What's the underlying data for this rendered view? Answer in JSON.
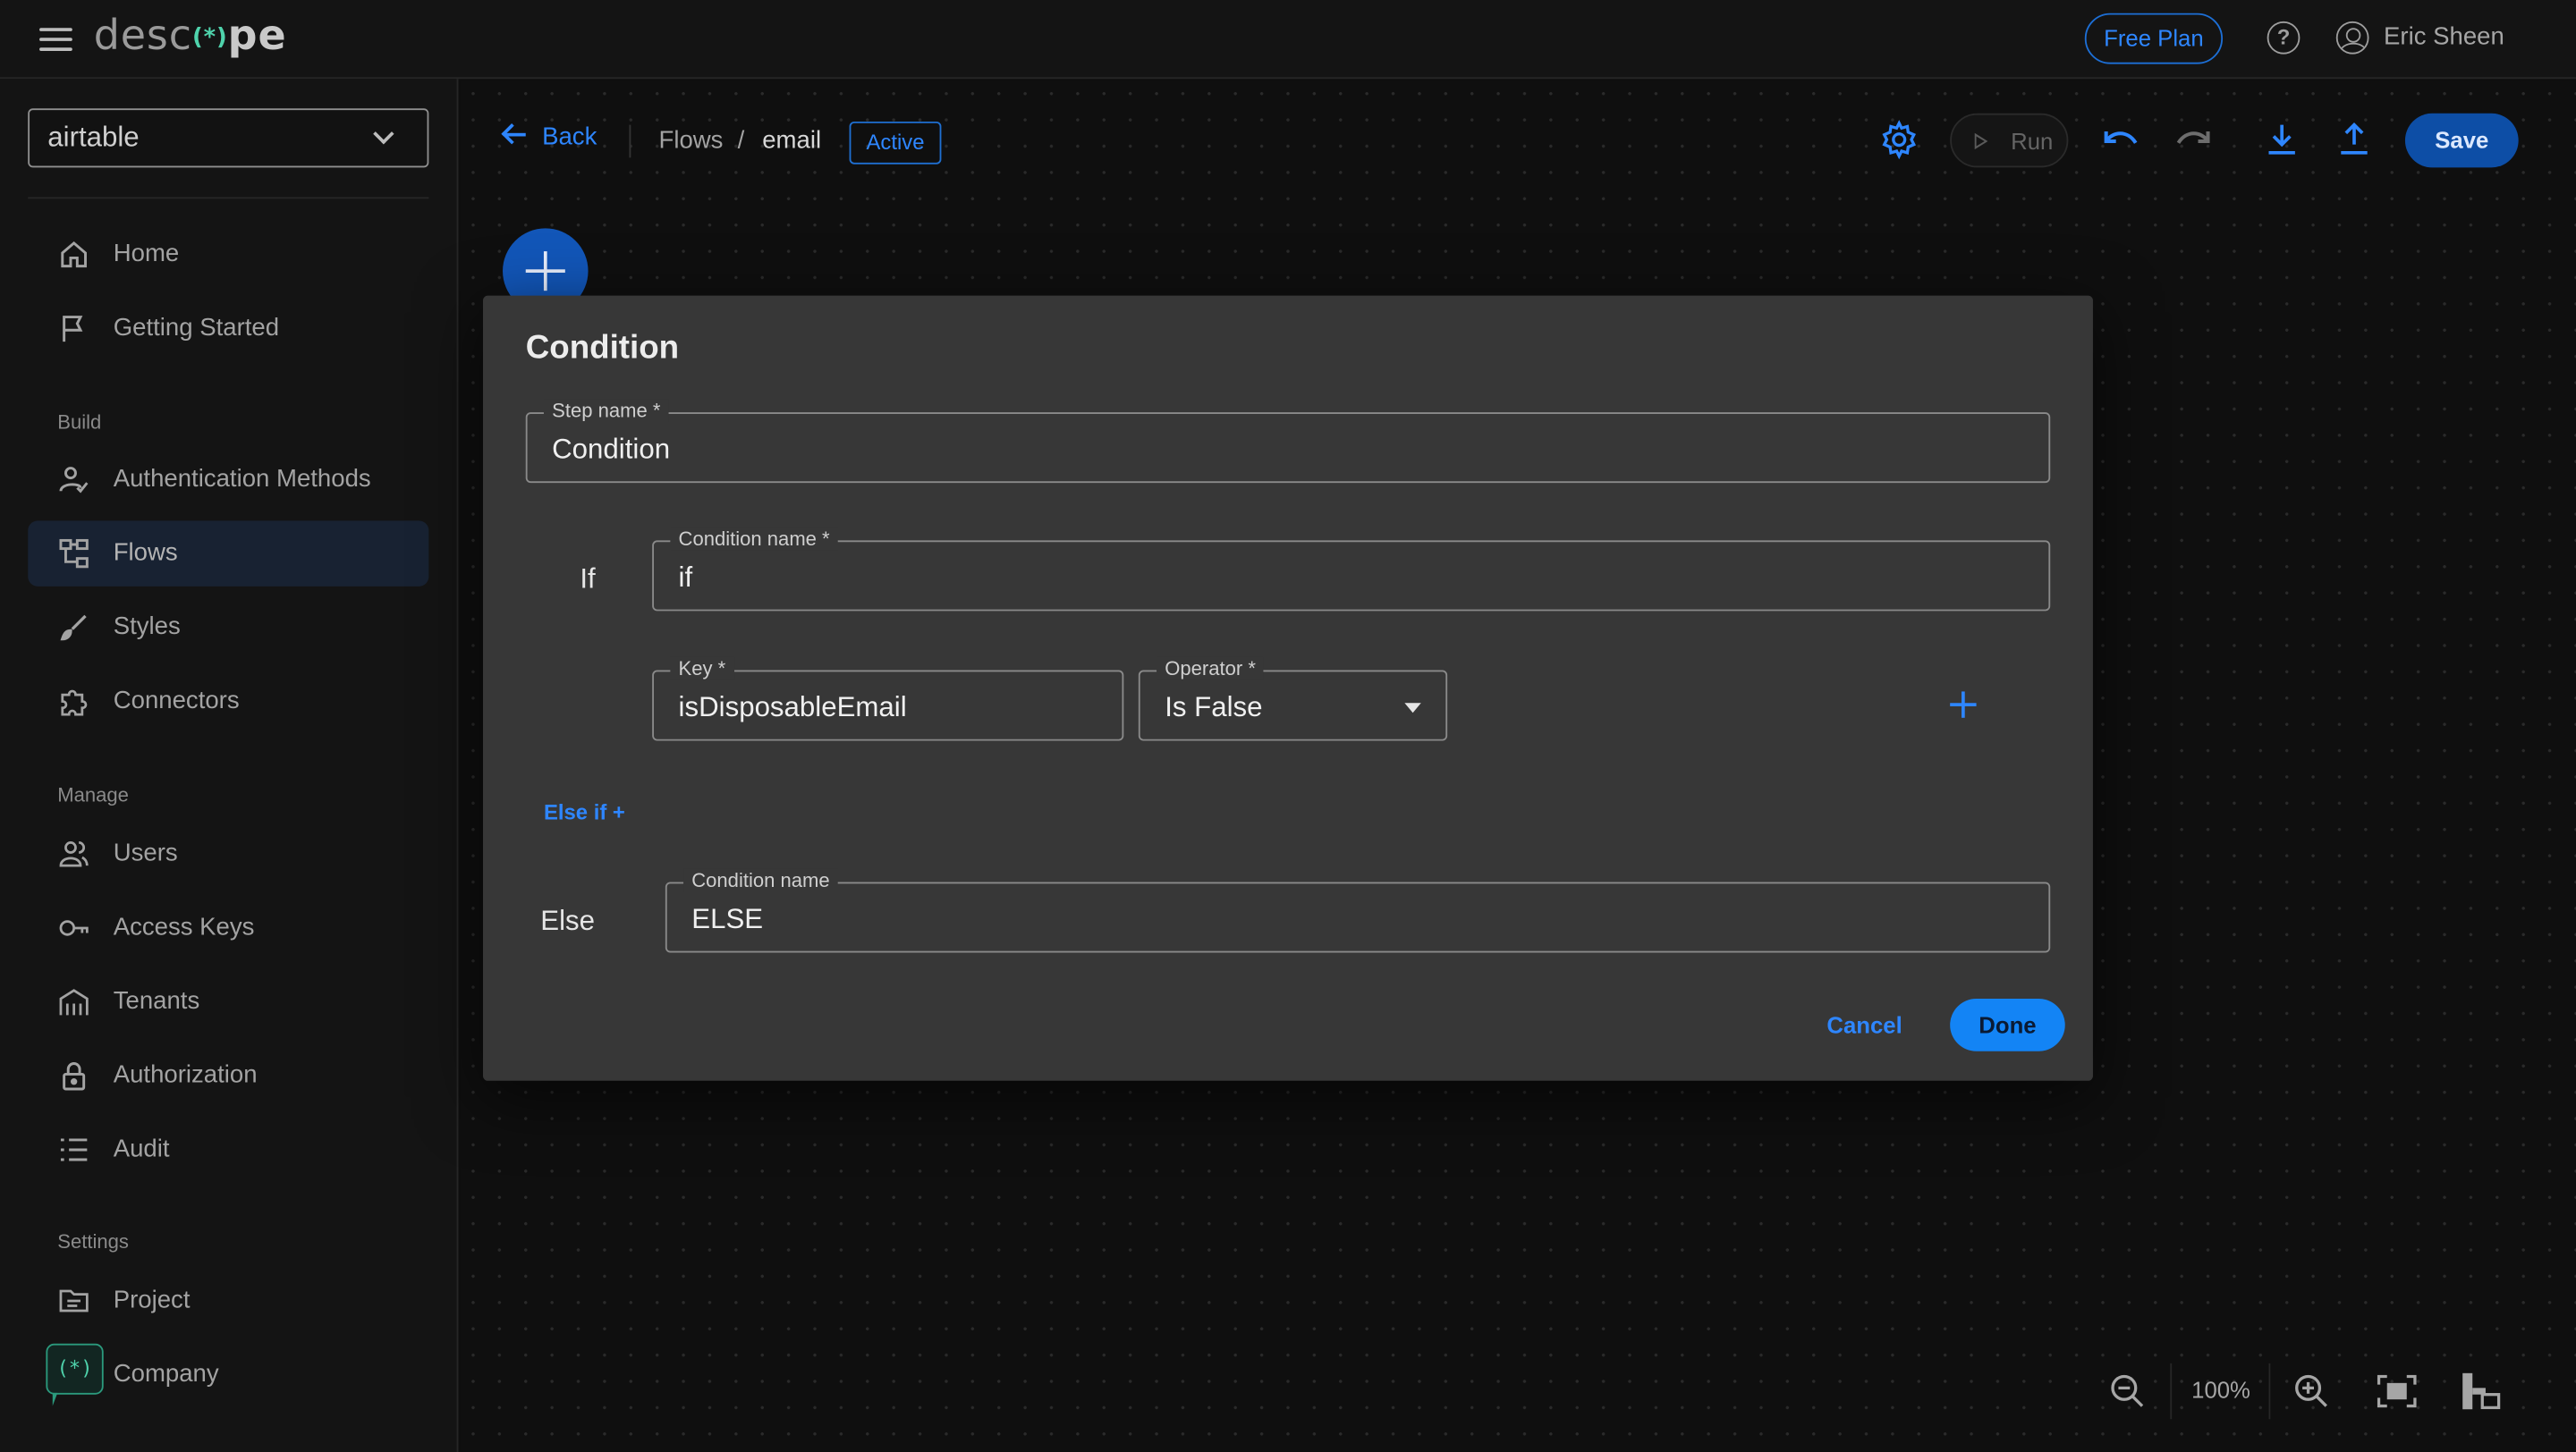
{
  "header": {
    "logo_light": "desc",
    "logo_bold": "(*)",
    "logo_tail": "pe",
    "free_plan": "Free Plan",
    "user_name": "Eric Sheen"
  },
  "sidebar": {
    "project": "airtable",
    "sections": {
      "build": "Build",
      "manage": "Manage",
      "settings": "Settings"
    },
    "items": [
      {
        "label": "Home",
        "icon": "home-icon"
      },
      {
        "label": "Getting Started",
        "icon": "flag-icon"
      },
      {
        "label": "Authentication Methods",
        "icon": "user-check-icon"
      },
      {
        "label": "Flows",
        "icon": "flows-icon"
      },
      {
        "label": "Styles",
        "icon": "brush-icon"
      },
      {
        "label": "Connectors",
        "icon": "puzzle-icon"
      },
      {
        "label": "Users",
        "icon": "users-icon"
      },
      {
        "label": "Access Keys",
        "icon": "key-icon"
      },
      {
        "label": "Tenants",
        "icon": "building-icon"
      },
      {
        "label": "Authorization",
        "icon": "lock-icon"
      },
      {
        "label": "Audit",
        "icon": "list-icon"
      },
      {
        "label": "Project",
        "icon": "folder-icon"
      },
      {
        "label": "Company",
        "icon": "company-icon"
      }
    ],
    "chat_badge": "(*)"
  },
  "toolbar": {
    "back": "Back",
    "crumb_flows": "Flows",
    "crumb_sep": "/",
    "crumb_current": "email",
    "status": "Active",
    "run": "Run",
    "save": "Save"
  },
  "zoom": {
    "level": "100%"
  },
  "dialog": {
    "title": "Condition",
    "step_name_label": "Step name *",
    "step_name_value": "Condition",
    "if_label": "If",
    "condition_name_label": "Condition name *",
    "condition_name_value": "if",
    "key_label": "Key *",
    "key_value": "isDisposableEmail",
    "operator_label": "Operator *",
    "operator_value": "Is False",
    "else_if": "Else if +",
    "else_label": "Else",
    "else_condition_label": "Condition name",
    "else_condition_value": "ELSE",
    "cancel": "Cancel",
    "done": "Done"
  },
  "colors": {
    "accent": "#2e86ff",
    "done_button": "#1384f5",
    "save_button": "#0d4ea6",
    "dialog_bg": "#373737"
  }
}
